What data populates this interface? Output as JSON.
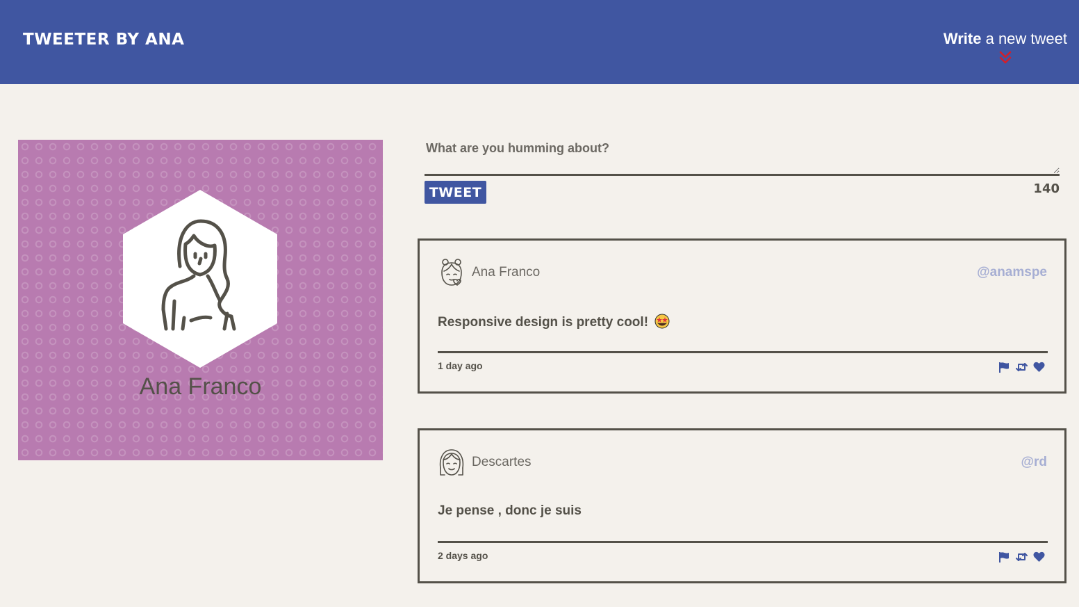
{
  "nav": {
    "brand": "Tweeter by Ana",
    "compose_strong": "Write",
    "compose_rest": " a new tweet",
    "toggle_icon": "double-chevron-down-icon"
  },
  "profile": {
    "name": "Ana Franco",
    "avatar_icon": "woman-avatar-icon"
  },
  "compose": {
    "placeholder": "What are you humming about?",
    "submit_label": "Tweet",
    "counter": "140"
  },
  "tweets": [
    {
      "author": "Ana Franco",
      "handle": "@anamspe",
      "content": "Responsive design is pretty cool!",
      "emoji": "star-struck-emoji",
      "time": "1 day ago",
      "actions": [
        "flag-icon",
        "retweet-icon",
        "heart-icon"
      ]
    },
    {
      "author": "Descartes",
      "handle": "@rd",
      "content": "Je pense , donc je suis",
      "time": "2 days ago",
      "actions": [
        "flag-icon",
        "retweet-icon",
        "heart-icon"
      ]
    }
  ],
  "colors": {
    "nav_bg": "#4056a1",
    "page_bg": "#f4f1ec",
    "profile_bg": "#b87bb0",
    "text": "#545149",
    "handle": "#a6aed3",
    "chevron": "#d21f2b"
  }
}
